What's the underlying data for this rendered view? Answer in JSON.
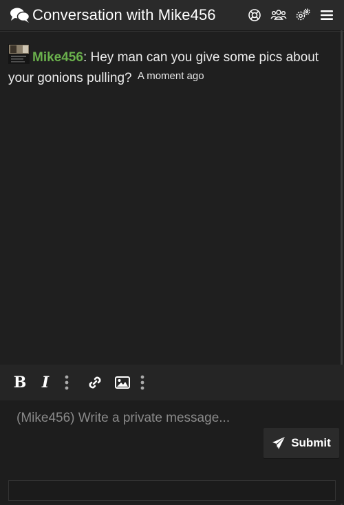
{
  "header": {
    "title": "Conversation with Mike456",
    "icons": [
      "conversation-icon",
      "lifebuoy-icon",
      "users-icon",
      "settings-icon",
      "menu-icon"
    ]
  },
  "messages": [
    {
      "author": "Mike456",
      "separator": ":",
      "text": " Hey man can you give some pics about your gonions pulling?",
      "time": "A moment ago"
    }
  ],
  "editor": {
    "toolbar": {
      "bold": "B",
      "italic": "I",
      "icons": [
        "more-vertical-icon",
        "link-icon",
        "image-icon",
        "more-vertical-icon"
      ]
    },
    "placeholder": "(Mike456) Write a private message...",
    "submit_label": "Submit"
  },
  "colors": {
    "background": "#1f1f1f",
    "header": "#2a2a2a",
    "username": "#6ab04c",
    "text": "#ececec"
  }
}
